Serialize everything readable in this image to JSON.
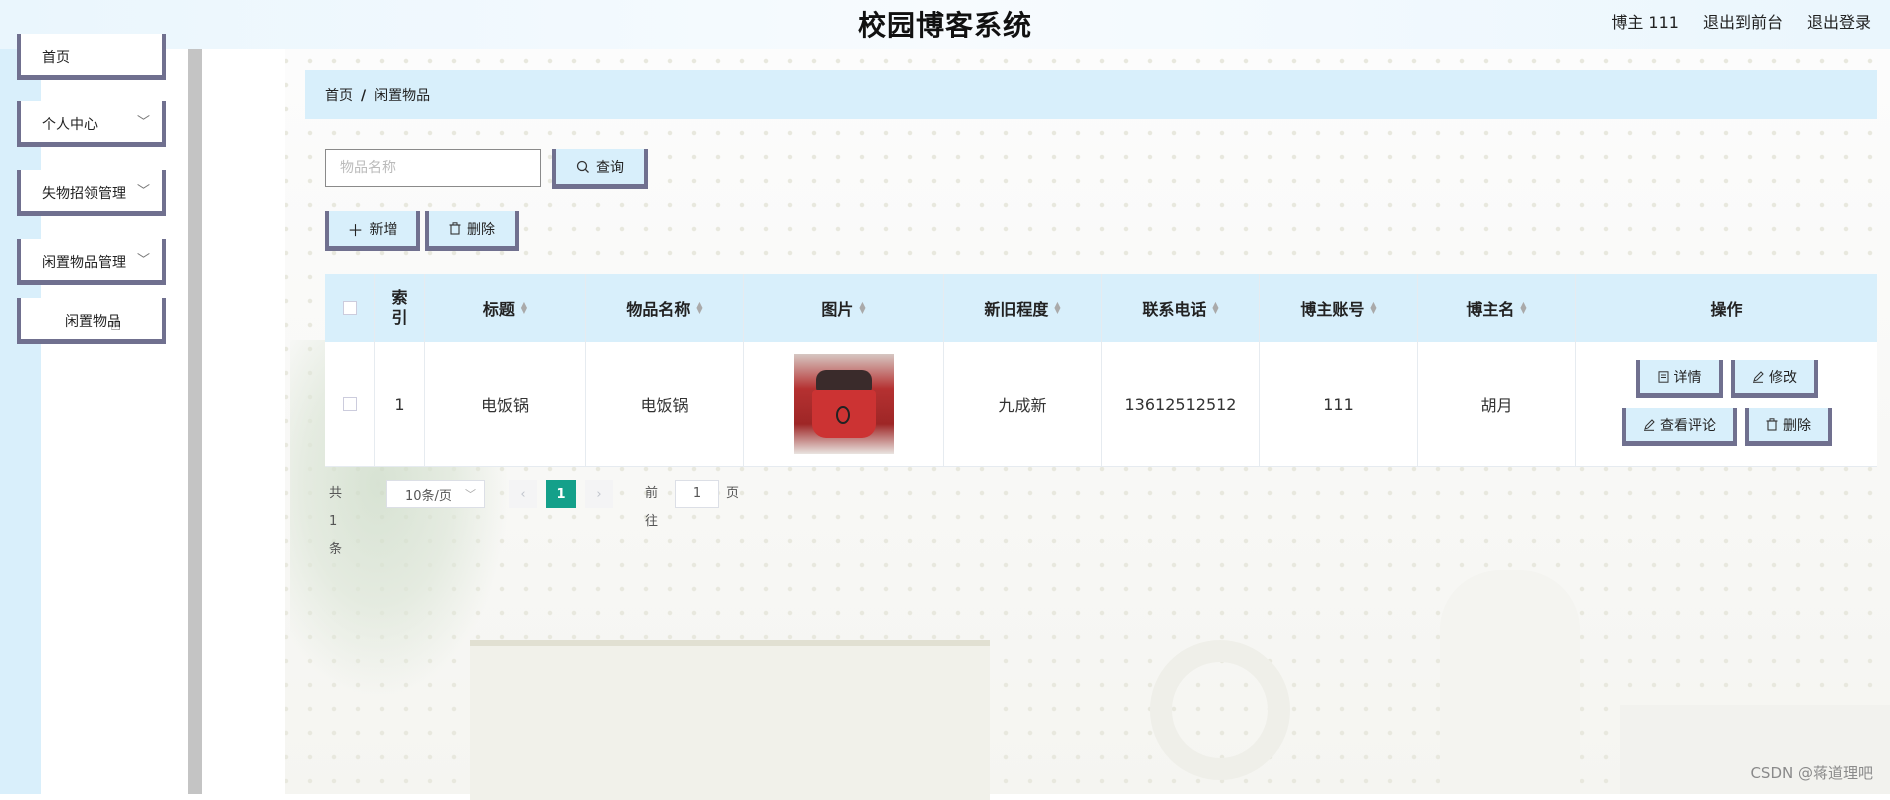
{
  "header": {
    "title": "校园博客系统",
    "user": "博主 111",
    "to_front": "退出到前台",
    "logout": "退出登录"
  },
  "sidebar": {
    "items": [
      {
        "label": "首页"
      },
      {
        "label": "个人中心"
      },
      {
        "label": "失物招领管理"
      },
      {
        "label": "闲置物品管理"
      },
      {
        "label": "闲置物品"
      }
    ]
  },
  "breadcrumb": {
    "home": "首页",
    "sep": "/",
    "current": "闲置物品"
  },
  "search": {
    "placeholder": "物品名称",
    "value": "",
    "button": "查询"
  },
  "actions": {
    "add": "新增",
    "delete": "删除"
  },
  "table": {
    "columns": [
      "索引",
      "标题",
      "物品名称",
      "图片",
      "新旧程度",
      "联系电话",
      "博主账号",
      "博主名",
      "操作"
    ],
    "index_header_lines": [
      "索",
      "引"
    ],
    "rows": [
      {
        "index": "1",
        "title": "电饭锅",
        "name": "电饭锅",
        "image": "rice-cooker-photo",
        "condition": "九成新",
        "phone": "13612512512",
        "account": "111",
        "blogger": "胡月"
      }
    ],
    "row_actions": {
      "detail": "详情",
      "edit": "修改",
      "comments": "查看评论",
      "delete": "删除"
    }
  },
  "pagination": {
    "total": "共 1 条",
    "page_size": "10条/页",
    "current_page": "1",
    "goto_prefix": "前往",
    "goto_value": "1",
    "goto_suffix": "页"
  },
  "watermark": "CSDN @蒋道理吧",
  "colors": {
    "accent": "#d8effb",
    "button_border": "#70708f",
    "active_page": "#14a08a"
  }
}
